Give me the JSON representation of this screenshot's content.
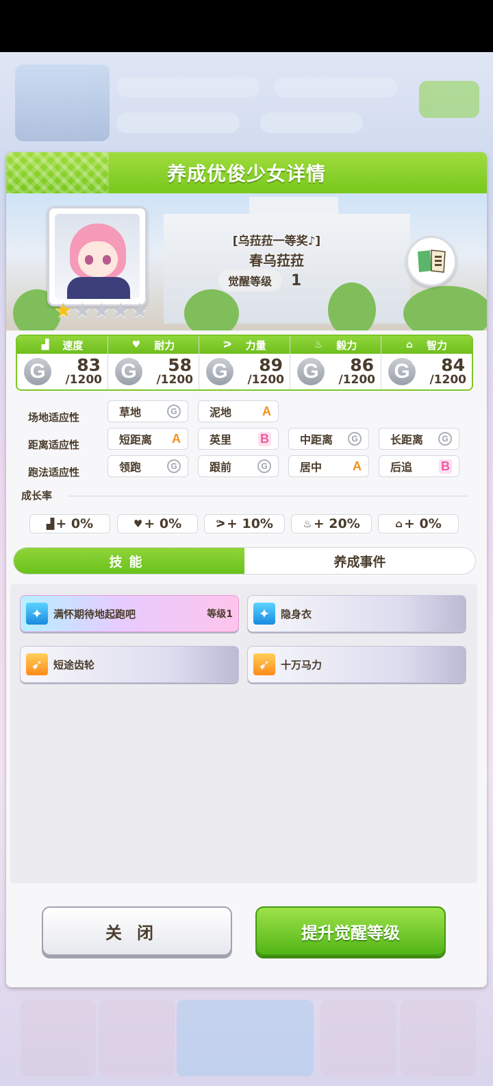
{
  "dialog": {
    "title": "养成优俊少女详情"
  },
  "character": {
    "epithet": "[乌菈菈一等奖♪]",
    "name": "春乌菈菈",
    "awaken_label": "觉醒等级",
    "awaken_level": "1",
    "stars_filled": 1,
    "stars_total": 5
  },
  "stats": [
    {
      "label": "速度",
      "icon": "shoe-icon",
      "grade": "G",
      "value": "83",
      "max": "/1200"
    },
    {
      "label": "耐力",
      "icon": "heart-icon",
      "grade": "G",
      "value": "58",
      "max": "/1200"
    },
    {
      "label": "力量",
      "icon": "muscle-icon",
      "grade": "G",
      "value": "89",
      "max": "/1200"
    },
    {
      "label": "毅力",
      "icon": "flame-icon",
      "grade": "G",
      "value": "86",
      "max": "/1200"
    },
    {
      "label": "智力",
      "icon": "graduation-cap-icon",
      "grade": "G",
      "value": "84",
      "max": "/1200"
    }
  ],
  "aptitude": {
    "track_label": "场地适应性",
    "track": [
      {
        "name": "草地",
        "grade": "G"
      },
      {
        "name": "泥地",
        "grade": "A"
      }
    ],
    "distance_label": "距离适应性",
    "distance": [
      {
        "name": "短距离",
        "grade": "A"
      },
      {
        "name": "英里",
        "grade": "B"
      },
      {
        "name": "中距离",
        "grade": "G"
      },
      {
        "name": "长距离",
        "grade": "G"
      }
    ],
    "style_label": "跑法适应性",
    "style": [
      {
        "name": "领跑",
        "grade": "G"
      },
      {
        "name": "跟前",
        "grade": "G"
      },
      {
        "name": "居中",
        "grade": "A"
      },
      {
        "name": "后追",
        "grade": "B"
      }
    ]
  },
  "growth": {
    "title": "成长率",
    "items": [
      {
        "icon": "shoe-icon",
        "value": "+ 0%"
      },
      {
        "icon": "heart-icon",
        "value": "+ 0%"
      },
      {
        "icon": "muscle-icon",
        "value": "+ 10%"
      },
      {
        "icon": "flame-icon",
        "value": "+ 20%"
      },
      {
        "icon": "graduation-cap-icon",
        "value": "+ 0%"
      }
    ]
  },
  "tabs": {
    "skills": "技能",
    "events": "养成事件"
  },
  "skills": [
    {
      "name": "满怀期待地起跑吧",
      "level": "等级1",
      "icon_color": "blue"
    },
    {
      "name": "隐身衣",
      "level": "",
      "icon_color": "blue"
    },
    {
      "name": "短途齿轮",
      "level": "",
      "icon_color": "orange"
    },
    {
      "name": "十万马力",
      "level": "",
      "icon_color": "orange"
    }
  ],
  "buttons": {
    "close": "关闭",
    "upgrade": "提升觉醒等级"
  },
  "colors": {
    "accent_green": "#78c81e",
    "text_brown": "#4a3c2c",
    "grade_a": "#f0901a",
    "grade_b": "#ef5ba0",
    "grade_g": "#9aa0aa"
  }
}
